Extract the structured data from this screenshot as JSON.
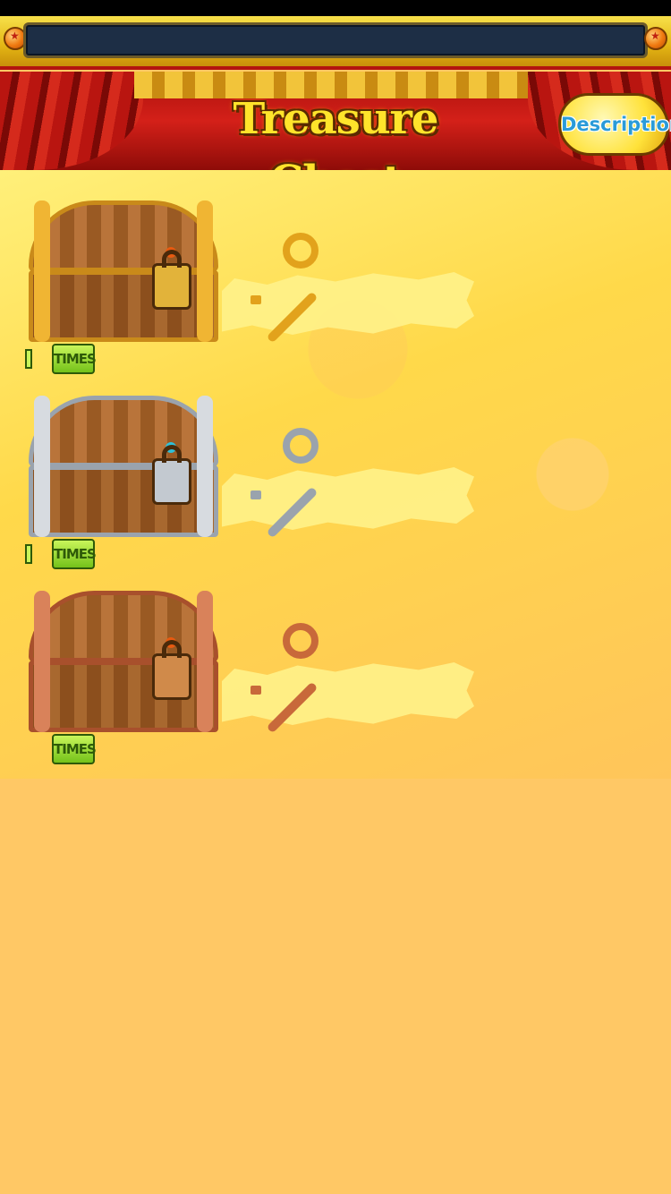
{
  "header": {
    "title_plate_text": "",
    "banner_title": "Treasure Chest",
    "description_label": "Description"
  },
  "chests": [
    {
      "tier": "gold",
      "count": "1",
      "times_label": "TIMES",
      "key_color": "#e2a21c",
      "trim_color": "#f0b533",
      "wood_color": "#a8682f"
    },
    {
      "tier": "silver",
      "count": "1",
      "times_label": "TIMES",
      "key_color": "#9aa3ad",
      "trim_color": "#d7dbe0",
      "wood_color": "#a8682f"
    },
    {
      "tier": "bronze",
      "count": "",
      "times_label": "TIMES",
      "key_color": "#c8693a",
      "trim_color": "#d9825a",
      "wood_color": "#a8682f"
    }
  ],
  "colors": {
    "background": "#ffc865",
    "banner_red": "#d42019",
    "title_yellow": "#ffe42b"
  }
}
